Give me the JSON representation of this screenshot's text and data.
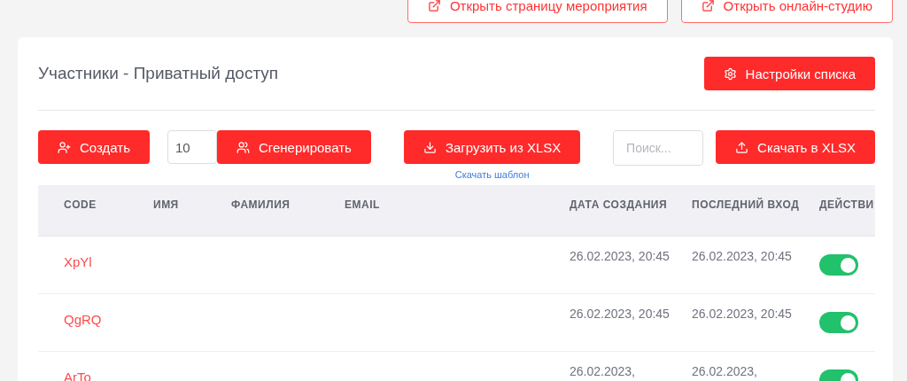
{
  "top_buttons": [
    "Открыть страницу мероприятия",
    "Открыть онлайн-студию"
  ],
  "card": {
    "title": "Участники - Приватный доступ",
    "settings_button": "Настройки списка"
  },
  "toolbar": {
    "create": "Создать",
    "count": "10",
    "generate": "Сгенерировать",
    "upload": "Загрузить из XLSX",
    "template_link": "Скачать шаблон",
    "search": {
      "placeholder": "Поиск..."
    },
    "download": "Скачать в XLSX"
  },
  "table": {
    "columns": [
      "CODE",
      "ИМЯ",
      "ФАМИЛИЯ",
      "EMAIL",
      "ДАТА СОЗДАНИЯ",
      "ПОСЛЕДНИЙ ВХОД",
      "ДЕЙСТВИ"
    ],
    "rows": [
      {
        "code": "XpYl",
        "created": "26.02.2023, 20:45",
        "last_login": "26.02.2023, 20:45",
        "on": true
      },
      {
        "code": "QgRQ",
        "created": "26.02.2023, 20:45",
        "last_login": "26.02.2023, 20:45",
        "on": true
      },
      {
        "code": "ArTo",
        "created": "26.02.2023,",
        "last_login": "26.02.2023,",
        "on": true
      }
    ]
  }
}
